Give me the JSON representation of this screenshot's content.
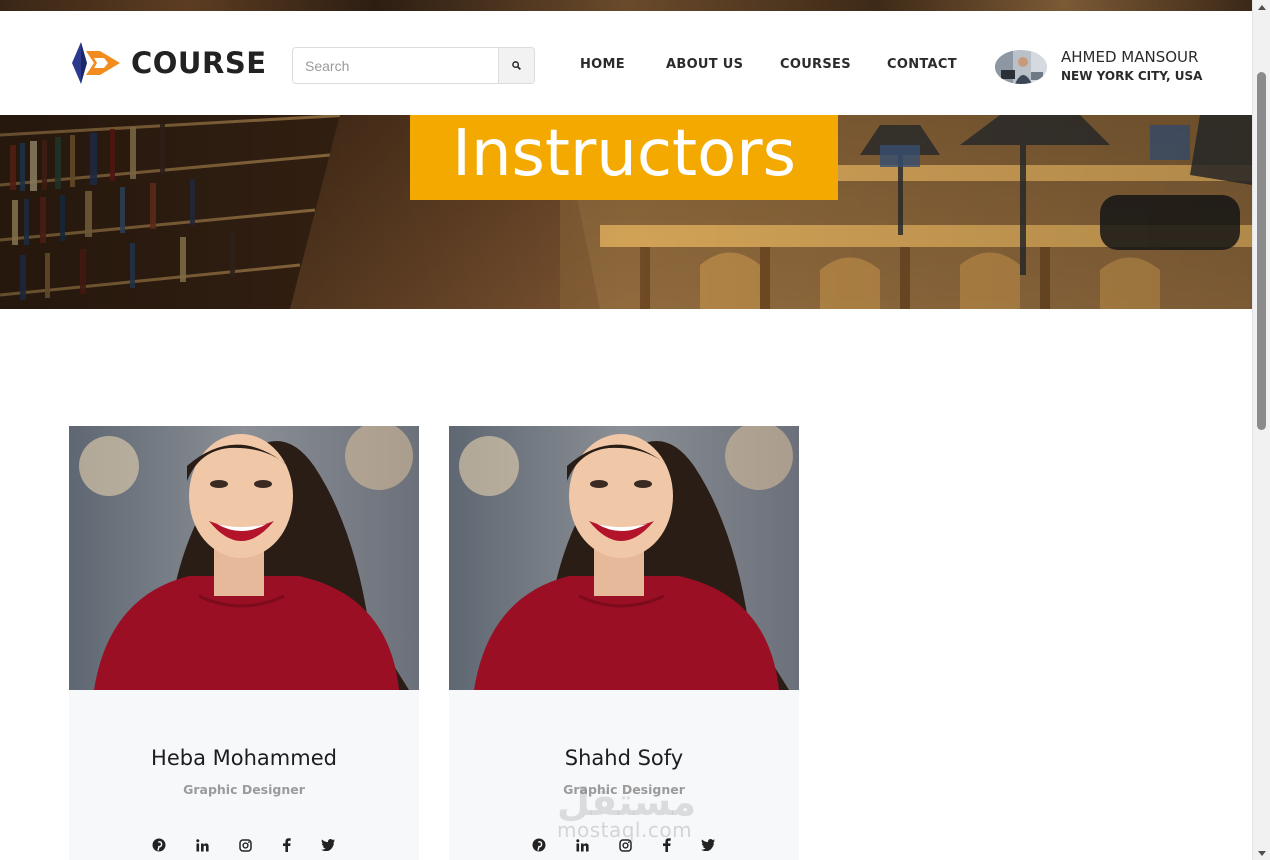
{
  "brand": {
    "name": "COURSE",
    "accent": "#f3a900",
    "logo_blue": "#2b3a8f",
    "logo_orange": "#f28c1e"
  },
  "search": {
    "placeholder": "Search",
    "icon": "search-icon"
  },
  "nav": {
    "items": [
      "HOME",
      "ABOUT US",
      "COURSES",
      "CONTACT"
    ]
  },
  "user": {
    "name": "AHMED MANSOUR",
    "location": "NEW YORK CITY, USA"
  },
  "hero": {
    "title": "Instructors"
  },
  "instructors": [
    {
      "name": "Heba Mohammed",
      "role": "Graphic Designer"
    },
    {
      "name": "Shahd Sofy",
      "role": "Graphic Designer"
    }
  ],
  "social_icons": [
    "pinterest-icon",
    "linkedin-icon",
    "instagram-icon",
    "facebook-icon",
    "twitter-icon"
  ],
  "watermark": {
    "arabic": "مستقل",
    "latin": "mostaql.com"
  }
}
